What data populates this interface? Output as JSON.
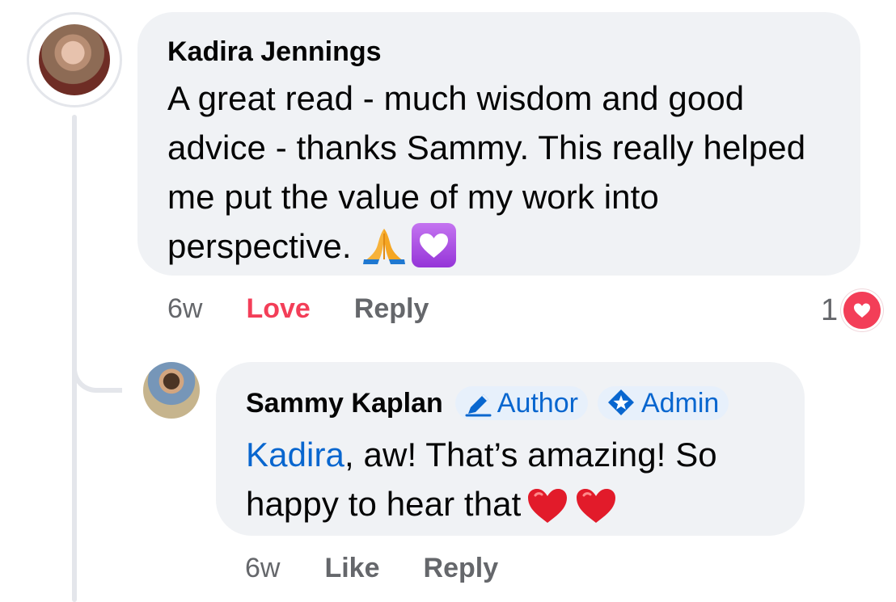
{
  "comments": [
    {
      "author": "Kadira Jennings",
      "text": "A great read - much wisdom and good advice - thanks Sammy. This really helped me put the value of my work into perspective.",
      "time": "6w",
      "actions": {
        "love": "Love",
        "reply": "Reply"
      },
      "reaction_count": "1",
      "reaction_type": "love",
      "emoji": [
        "folded-hands",
        "purple-heart"
      ]
    },
    {
      "author": "Sammy Kaplan",
      "badges": [
        "Author",
        "Admin"
      ],
      "mention": "Kadira",
      "text_after_mention": ", aw! That’s amazing! So happy to hear that",
      "time": "6w",
      "actions": {
        "like": "Like",
        "reply": "Reply"
      },
      "emoji": [
        "red-heart",
        "red-heart"
      ]
    }
  ],
  "colors": {
    "bubble": "#f0f2f5",
    "thread": "#e4e6eb",
    "love": "#f33e58",
    "link": "#0866cf",
    "meta": "#65676b"
  }
}
